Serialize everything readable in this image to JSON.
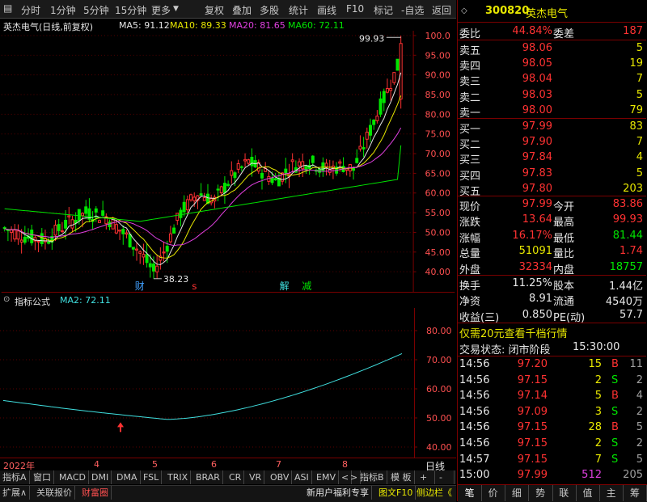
{
  "toolbar": {
    "items": [
      "分时",
      "1分钟",
      "5分钟",
      "15分钟",
      "更多",
      "复权",
      "叠加",
      "多股",
      "统计",
      "画线",
      "F10",
      "标记",
      "-自选",
      "返回"
    ]
  },
  "main_info": {
    "title": "英杰电气(日线,前复权)",
    "ma5": "MA5: 91.12",
    "ma10": "MA10: 89.33",
    "ma20": "MA20: 81.65",
    "ma60": "MA60: 72.11"
  },
  "price_axis": [
    "100.0",
    "95.00",
    "90.00",
    "85.00",
    "80.00",
    "75.00",
    "70.00",
    "65.00",
    "60.00",
    "55.00",
    "50.00",
    "45.00",
    "40.00"
  ],
  "annotations": {
    "high_label": "99.93",
    "low_label": "38.23",
    "marker_cai": "财",
    "marker_s": "s",
    "marker_jie": "解",
    "marker_jian": "减"
  },
  "indicator": {
    "title": "指标公式",
    "ma2": "MA2: 72.11",
    "axis": [
      "80.00",
      "70.00",
      "60.00",
      "50.00",
      "40.00"
    ]
  },
  "date_axis": {
    "year": "2022年",
    "months": [
      "4",
      "5",
      "6",
      "7",
      "8"
    ],
    "period": "日线"
  },
  "indicator_tabs": [
    "指标A",
    "窗口",
    "MACD",
    "DMI",
    "DMA",
    "FSL",
    "TRIX",
    "BRAR",
    "CR",
    "VR",
    "OBV",
    "ASI",
    "EMV",
    "<",
    ">",
    "指标B",
    "模 板",
    "+",
    "-"
  ],
  "bottom_tabs": [
    "扩展∧",
    "关联报价",
    "财富圈"
  ],
  "bottom_right": {
    "link1": "新用户福利专享",
    "link2": "图文F10",
    "link3": "侧边栏《"
  },
  "quote": {
    "code": "300820",
    "name": "英杰电气",
    "weibi_label": "委比",
    "weibi": "44.84%",
    "weicha_label": "委差",
    "weicha": "187",
    "sells": [
      {
        "label": "卖五",
        "price": "98.06",
        "vol": "5"
      },
      {
        "label": "卖四",
        "price": "98.05",
        "vol": "19"
      },
      {
        "label": "卖三",
        "price": "98.04",
        "vol": "7"
      },
      {
        "label": "卖二",
        "price": "98.03",
        "vol": "5"
      },
      {
        "label": "卖一",
        "price": "98.00",
        "vol": "79"
      }
    ],
    "buys": [
      {
        "label": "买一",
        "price": "97.99",
        "vol": "83"
      },
      {
        "label": "买二",
        "price": "97.90",
        "vol": "7"
      },
      {
        "label": "买三",
        "price": "97.84",
        "vol": "4"
      },
      {
        "label": "买四",
        "price": "97.83",
        "vol": "5"
      },
      {
        "label": "买五",
        "price": "97.80",
        "vol": "203"
      }
    ],
    "stats": [
      {
        "l1": "现价",
        "v1": "97.99",
        "l2": "今开",
        "v2": "83.86"
      },
      {
        "l1": "涨跌",
        "v1": "13.64",
        "l2": "最高",
        "v2": "99.93"
      },
      {
        "l1": "涨幅",
        "v1": "16.17%",
        "l2": "最低",
        "v2": "81.44"
      },
      {
        "l1": "总量",
        "v1": "51091",
        "l2": "量比",
        "v2": "1.74"
      },
      {
        "l1": "外盘",
        "v1": "32334",
        "l2": "内盘",
        "v2": "18757"
      }
    ],
    "stats2": [
      {
        "l1": "换手",
        "v1": "11.25%",
        "l2": "股本",
        "v2": "1.44亿"
      },
      {
        "l1": "净资",
        "v1": "8.91",
        "l2": "流通",
        "v2": "4540万"
      },
      {
        "l1": "收益(三)",
        "v1": "0.850",
        "l2": "PE(动)",
        "v2": "57.7"
      }
    ],
    "promo": "仅需20元查看千档行情",
    "status_label": "交易状态: 闭市阶段",
    "status_time": "15:30:00",
    "ticks": [
      {
        "t": "14:56",
        "p": "97.20",
        "v": "15",
        "d": "B",
        "n": "11"
      },
      {
        "t": "14:56",
        "p": "97.15",
        "v": "2",
        "d": "S",
        "n": "2"
      },
      {
        "t": "14:56",
        "p": "97.14",
        "v": "5",
        "d": "B",
        "n": "4"
      },
      {
        "t": "14:56",
        "p": "97.09",
        "v": "3",
        "d": "S",
        "n": "2"
      },
      {
        "t": "14:56",
        "p": "97.15",
        "v": "28",
        "d": "B",
        "n": "5"
      },
      {
        "t": "14:56",
        "p": "97.15",
        "v": "2",
        "d": "S",
        "n": "2"
      },
      {
        "t": "14:57",
        "p": "97.15",
        "v": "7",
        "d": "S",
        "n": "5"
      },
      {
        "t": "15:00",
        "p": "97.99",
        "v": "512",
        "d": "",
        "n": "205"
      }
    ],
    "footer_tabs": [
      "笔",
      "价",
      "细",
      "势",
      "联",
      "值",
      "主",
      "筹"
    ]
  },
  "colors": {
    "up": "#ff3232",
    "down": "#00e600",
    "ma5": "#e6e6e6",
    "ma10": "#e8e800",
    "ma20": "#e040e0",
    "ma60": "#00e600",
    "ma2": "#40e0e0",
    "border": "#7a0000"
  }
}
